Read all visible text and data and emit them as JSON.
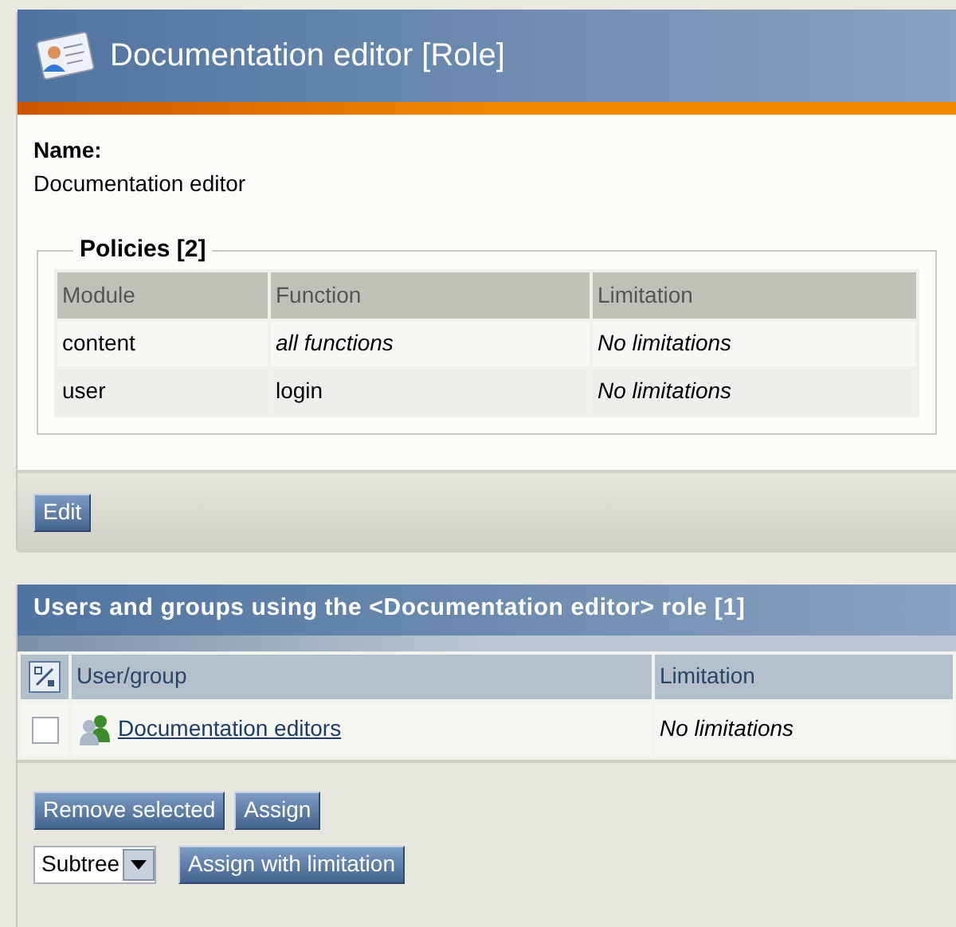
{
  "role_panel": {
    "title": "Documentation editor [Role]",
    "name_label": "Name:",
    "name_value": "Documentation editor",
    "policies": {
      "legend": "Policies [2]",
      "columns": [
        "Module",
        "Function",
        "Limitation"
      ],
      "rows": [
        {
          "module": "content",
          "function": "all functions",
          "function_italic": true,
          "limitation": "No limitations"
        },
        {
          "module": "user",
          "function": "login",
          "function_italic": false,
          "limitation": "No limitations"
        }
      ]
    },
    "buttons": [
      "Edit"
    ]
  },
  "assignments_panel": {
    "title": "Users and groups using the <Documentation editor> role [1]",
    "columns": [
      "User/group",
      "Limitation"
    ],
    "rows": [
      {
        "name": "Documentation editors",
        "checked": false,
        "limitation": "No limitations"
      }
    ],
    "buttons": [
      "Remove selected",
      "Assign"
    ],
    "scope_select": {
      "value": "Subtree"
    },
    "limit_button": "Assign with limitation"
  }
}
